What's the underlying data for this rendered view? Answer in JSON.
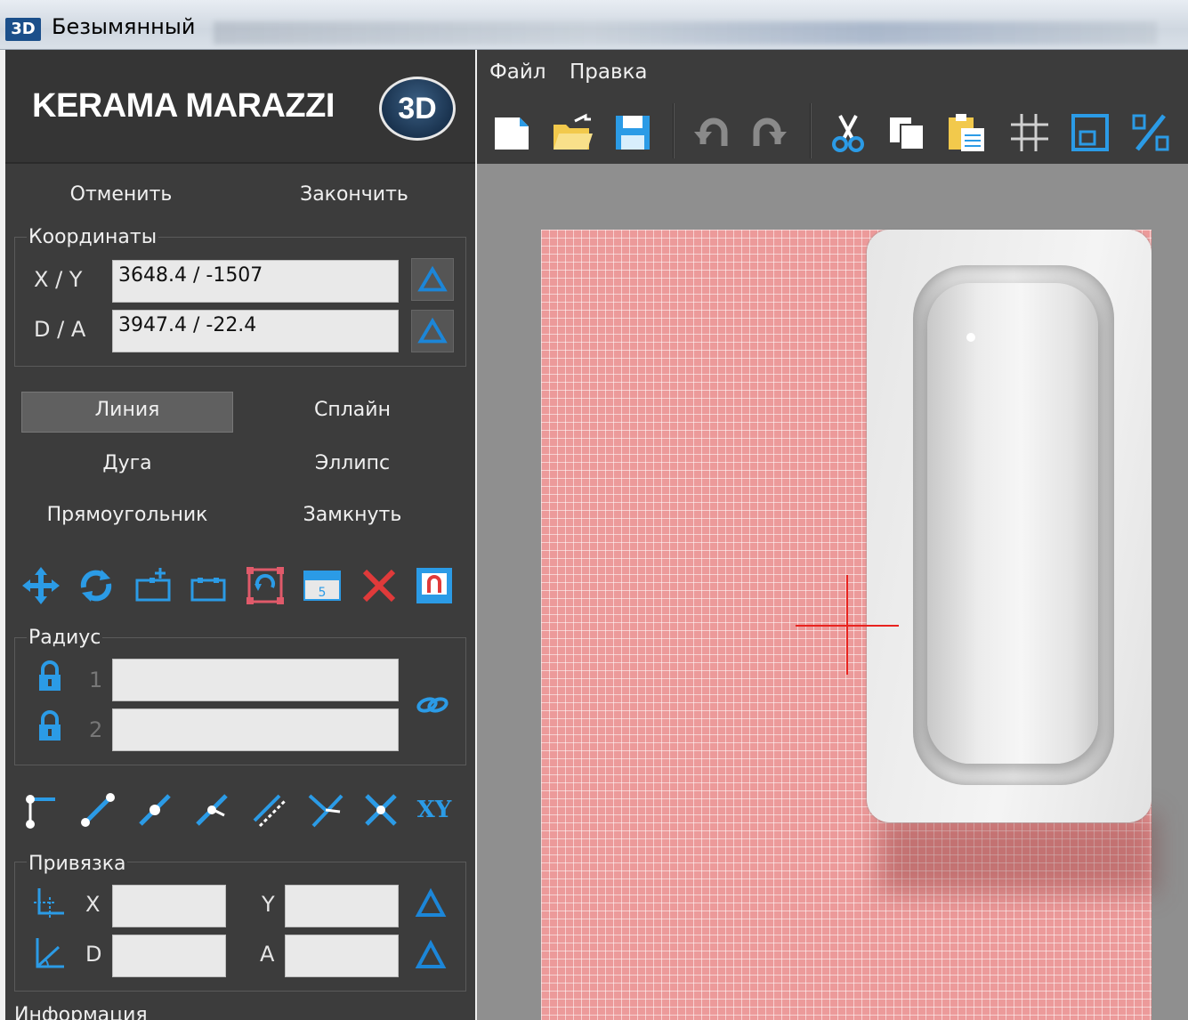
{
  "window": {
    "icon_label": "3D",
    "title": "Безымянный"
  },
  "logo": {
    "brand": "KERAMA MARAZZI",
    "badge": "3D"
  },
  "actions": {
    "cancel": "Отменить",
    "finish": "Закончить"
  },
  "coordinates": {
    "label": "Координаты",
    "xy_label": "X / Y",
    "xy_value": "3648.4 / -1507",
    "da_label": "D / A",
    "da_value": "3947.4 / -22.4"
  },
  "draw_modes": {
    "line": "Линия",
    "spline": "Сплайн",
    "arc": "Дуга",
    "ellipse": "Эллипс",
    "rectangle": "Прямоугольник",
    "close": "Замкнуть",
    "selected": "Линия"
  },
  "radius": {
    "label": "Радиус",
    "row1": "1",
    "row2": "2",
    "value1": "",
    "value2": ""
  },
  "snap_tools": {
    "xy_label": "XY"
  },
  "snap": {
    "label": "Привязка",
    "x_label": "X",
    "y_label": "Y",
    "d_label": "D",
    "a_label": "A",
    "x_value": "",
    "y_value": "",
    "d_value": "",
    "a_value": ""
  },
  "info": {
    "label": "Информация"
  },
  "menu": {
    "file": "Файл",
    "edit": "Правка"
  },
  "colors": {
    "panel_bg": "#3c3c3c",
    "accent_triangle": "#1c86d8",
    "crosshair": "#e8231f",
    "floor_tile": "#ec9a9a"
  },
  "icons": {
    "toolbar": [
      "new-file-icon",
      "open-folder-icon",
      "save-icon",
      "undo-icon",
      "redo-icon",
      "cut-icon",
      "copy-icon",
      "paste-icon",
      "grid-icon",
      "window-icon",
      "percent-icon"
    ],
    "edit_tools": [
      "move-icon",
      "rotate-icon",
      "add-point-icon",
      "remove-point-icon",
      "transform-icon",
      "measure-icon",
      "delete-icon",
      "magnet-icon"
    ],
    "snap_tools": [
      "snap-endpoint-icon",
      "snap-segment-icon",
      "snap-midpoint-icon",
      "snap-perpendicular-icon",
      "snap-parallel-icon",
      "snap-bisector-icon",
      "snap-intersection-icon",
      "snap-xy-icon"
    ]
  }
}
